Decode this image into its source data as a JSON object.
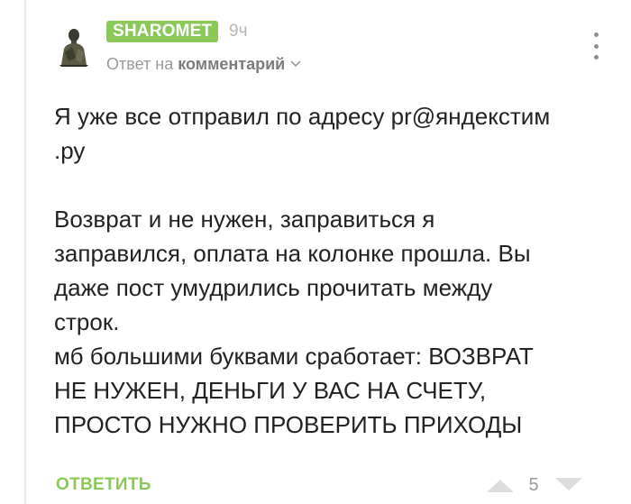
{
  "comment": {
    "author": "SHAROMET",
    "time": "9ч",
    "reply_prefix": "Ответ на",
    "reply_target": "комментарий",
    "text": "Я уже все отправил по адресу pr@яндекстим\n.ру\n\nВозврат и не нужен, заправиться я\nзаправился, оплата на колонке прошла. Вы\nдаже пост умудрились прочитать между\nстрок.\nмб большими буквами сработает: ВОЗВРАТ\nНЕ НУЖЕН, ДЕНЬГИ У ВАС НА СЧЕТУ,\nПРОСТО НУЖНО ПРОВЕРИТЬ ПРИХОДЫ",
    "reply_label": "ОТВЕТИТЬ",
    "rating": "5"
  },
  "icons": {
    "avatar": "avatar",
    "reply_chevron": "chevron-down-icon",
    "menu": "more-vertical-icon",
    "vote_up": "arrow-up-icon",
    "vote_down": "arrow-down-icon"
  },
  "colors": {
    "accent_green": "#8ac858",
    "muted_text": "#9a9a9a",
    "body_text": "#222222"
  }
}
